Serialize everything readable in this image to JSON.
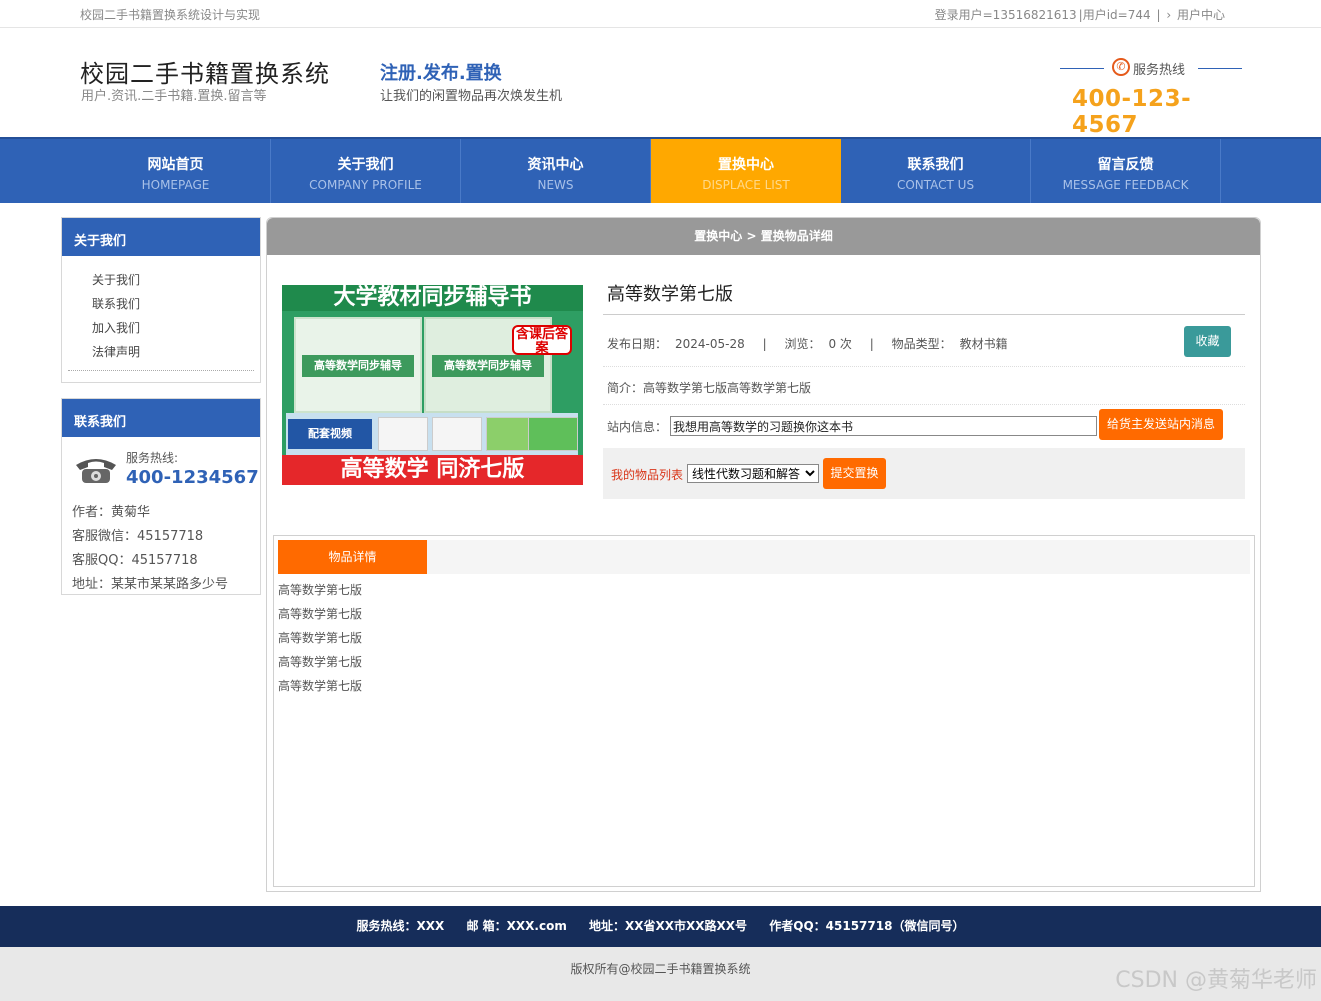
{
  "topbar": {
    "site_caption": "校园二手书籍置换系统设计与实现",
    "login_user": "登录用户=13516821613",
    "user_id": "|用户id=744",
    "sep": "|",
    "arrow": "›",
    "user_center": "用户中心"
  },
  "header": {
    "title": "校园二手书籍置换系统",
    "subtitle": "用户.资讯.二手书籍.置换.留言等",
    "slogan": "注册.发布.置换",
    "slogan_sub": "让我们的闲置物品再次焕发生机",
    "hotline_label": "服务热线",
    "hotline_number": "400-123-4567"
  },
  "nav": [
    {
      "zh": "网站首页",
      "en": "HOMEPAGE"
    },
    {
      "zh": "关于我们",
      "en": "COMPANY PROFILE"
    },
    {
      "zh": "资讯中心",
      "en": "NEWS"
    },
    {
      "zh": "置换中心",
      "en": "DISPLACE LIST"
    },
    {
      "zh": "联系我们",
      "en": "CONTACT US"
    },
    {
      "zh": "留言反馈",
      "en": "MESSAGE FEEDBACK"
    }
  ],
  "sidebar": {
    "about_title": "关于我们",
    "about_items": [
      "关于我们",
      "联系我们",
      "加入我们",
      "法律声明"
    ],
    "contact_title": "联系我们",
    "tel_label": "服务热线:",
    "tel_number": "400-1234567",
    "author": "作者：黄菊华",
    "wechat": "客服微信：45157718",
    "qq": "客服QQ：45157718",
    "address": "地址：某某市某某路多少号"
  },
  "main": {
    "breadcrumb": "置换中心 > 置换物品详细",
    "cover": {
      "top": "大学教材同步辅导书",
      "book_title": "高等数学同步辅导",
      "badge": "含课后答案",
      "video": "配套视频",
      "bottom": "高等数学 同济七版"
    },
    "title": "高等数学第七版",
    "date_label": "发布日期：",
    "date": "2024-05-28",
    "views_label": "浏览：",
    "views": "0 次",
    "type_label": "物品类型：",
    "type": "教材书籍",
    "sep": "|",
    "fav_button": "收藏",
    "intro": "简介：高等数学第七版高等数学第七版",
    "msg_label": "站内信息：",
    "msg_value": "我想用高等数学的习题换你这本书",
    "send_button": "给货主发送站内消息",
    "my_items_label": "我的物品列表",
    "my_items_selected": "线性代数习题和解答",
    "submit_button": "提交置换",
    "tab_label": "物品详情",
    "detail_lines": [
      "高等数学第七版",
      "高等数学第七版",
      "高等数学第七版",
      "高等数学第七版",
      "高等数学第七版"
    ]
  },
  "footer": {
    "hotline": "服务热线：XXX",
    "email": "邮 箱：XXX.com",
    "address": "地址：XX省XX市XX路XX号",
    "author_qq": "作者QQ：45157718（微信同号）",
    "copyright": "版权所有@校园二手书籍置换系统",
    "watermark": "CSDN @黄菊华老师"
  }
}
